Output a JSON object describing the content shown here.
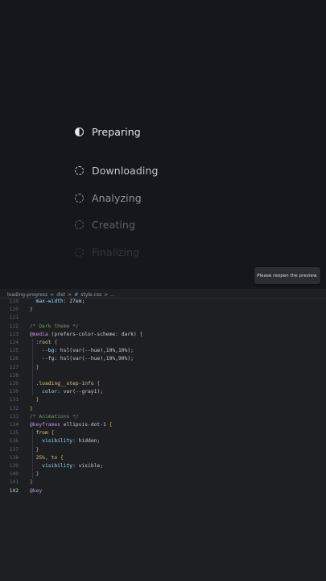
{
  "preview": {
    "steps": [
      {
        "label": "Preparing",
        "state": "active"
      },
      {
        "label": "Downloading",
        "state": "pending"
      },
      {
        "label": "Analyzing",
        "state": "pending"
      },
      {
        "label": "Creating",
        "state": "pending"
      },
      {
        "label": "Finalizing",
        "state": "pending"
      }
    ],
    "toast": "Please reopen the preview."
  },
  "breadcrumb": {
    "items": [
      "loading-progress",
      "dist",
      "style.css",
      "..."
    ],
    "sep": ">",
    "file_icon": "#"
  },
  "code": {
    "lines": [
      {
        "n": "119",
        "t": "  max-width: 27em;"
      },
      {
        "n": "120",
        "t": "}"
      },
      {
        "n": "121",
        "t": ""
      },
      {
        "n": "122",
        "t": "/* Dark theme */"
      },
      {
        "n": "123",
        "t": "@media (prefers-color-scheme: dark) {"
      },
      {
        "n": "124",
        "t": "  :root {"
      },
      {
        "n": "125",
        "t": "    --bg: hsl(var(--hue),10%,10%);"
      },
      {
        "n": "126",
        "t": "    --fg: hsl(var(--hue),10%,90%);"
      },
      {
        "n": "127",
        "t": "  }"
      },
      {
        "n": "128",
        "t": ""
      },
      {
        "n": "129",
        "t": "  .loading__step-info {"
      },
      {
        "n": "130",
        "t": "    color: var(--gray1);"
      },
      {
        "n": "131",
        "t": "  }"
      },
      {
        "n": "132",
        "t": "}"
      },
      {
        "n": "133",
        "t": "/* Animations */"
      },
      {
        "n": "134",
        "t": "@keyframes ellipsis-dot-1 {"
      },
      {
        "n": "135",
        "t": "  from {"
      },
      {
        "n": "136",
        "t": "    visibility: hidden;"
      },
      {
        "n": "137",
        "t": "  }"
      },
      {
        "n": "138",
        "t": "  25%, to {"
      },
      {
        "n": "139",
        "t": "    visibility: visible;"
      },
      {
        "n": "140",
        "t": "  }"
      },
      {
        "n": "141",
        "t": "}"
      },
      {
        "n": "142",
        "t": "@key"
      }
    ],
    "current_line": "142"
  },
  "colors": {
    "preview_bg": "#15171c",
    "editor_bg": "#1d1f23",
    "accent": "#4d9be0"
  }
}
